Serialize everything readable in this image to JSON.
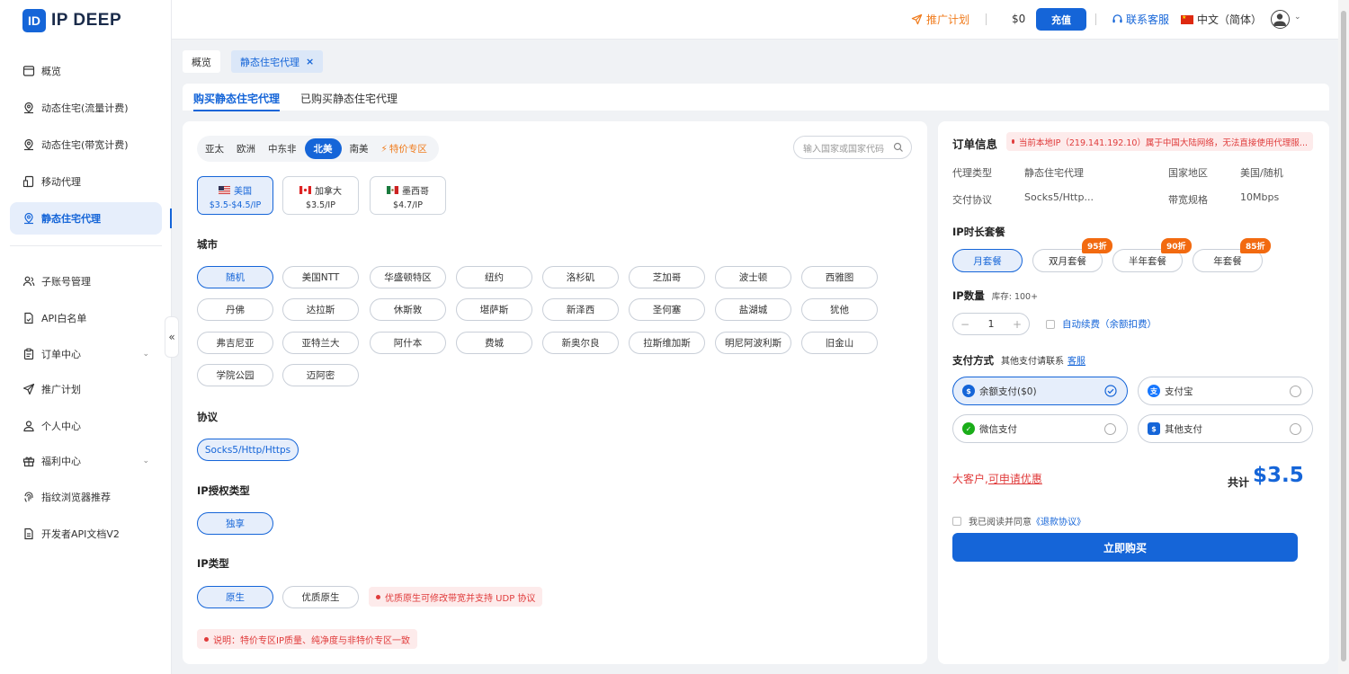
{
  "brand": {
    "logo_letter": "ID",
    "name": "IP DEEP"
  },
  "sidebar": {
    "items": [
      {
        "label": "概览"
      },
      {
        "label": "动态住宅(流量计费)"
      },
      {
        "label": "动态住宅(带宽计费)"
      },
      {
        "label": "移动代理"
      },
      {
        "label": "静态住宅代理"
      },
      {
        "label": "子账号管理"
      },
      {
        "label": "API白名单"
      },
      {
        "label": "订单中心"
      },
      {
        "label": "推广计划"
      },
      {
        "label": "个人中心"
      },
      {
        "label": "福利中心"
      },
      {
        "label": "指纹浏览器推荐"
      },
      {
        "label": "开发者API文档V2"
      }
    ],
    "collapse_glyph": "«"
  },
  "topbar": {
    "promo": "推广计划",
    "balance": "$0",
    "recharge": "充值",
    "service": "联系客服",
    "language": "中文（简体）"
  },
  "tabs": {
    "overview": "概览",
    "current": "静态住宅代理",
    "close": "×"
  },
  "subtabs": {
    "buy": "购买静态住宅代理",
    "purchased": "已购买静态住宅代理"
  },
  "regions": [
    "亚太",
    "欧洲",
    "中东非",
    "北美",
    "南美",
    "特价专区"
  ],
  "search_placeholder": "输入国家或国家代码",
  "countries": [
    {
      "name": "美国",
      "price": "$3.5-$4.5/IP"
    },
    {
      "name": "加拿大",
      "price": "$3.5/IP"
    },
    {
      "name": "墨西哥",
      "price": "$4.7/IP"
    }
  ],
  "city_label": "城市",
  "cities": [
    [
      "随机",
      "美国NTT",
      "华盛顿特区",
      "纽约",
      "洛杉矶",
      "芝加哥",
      "波士顿",
      "西雅图"
    ],
    [
      "丹佛",
      "达拉斯",
      "休斯敦",
      "堪萨斯",
      "新泽西",
      "圣何塞",
      "盐湖城",
      "犹他"
    ],
    [
      "弗吉尼亚",
      "亚特兰大",
      "阿什本",
      "费城",
      "新奥尔良",
      "拉斯维加斯",
      "明尼阿波利斯",
      "旧金山"
    ],
    [
      "学院公园",
      "迈阿密"
    ]
  ],
  "protocol_label": "协议",
  "protocol": "Socks5/Http/Https",
  "auth_label": "IP授权类型",
  "auth": "独享",
  "iptype_label": "IP类型",
  "iptypes": [
    "原生",
    "优质原生"
  ],
  "iptype_note": "优质原生可修改带宽并支持 UDP 协议",
  "footer_note": "说明：特价专区IP质量、纯净度与非特价专区一致",
  "order": {
    "title": "订单信息",
    "warning": "当前本地IP（219.141.192.10）属于中国大陆网络，无法直接使用代理服...",
    "proxy_type_k": "代理类型",
    "proxy_type_v": "静态住宅代理",
    "region_k": "国家地区",
    "region_v": "美国/随机",
    "protocol_k": "交付协议",
    "protocol_v": "Socks5/Http...",
    "bandwidth_k": "带宽规格",
    "bandwidth_v": "10Mbps",
    "duration_label": "IP时长套餐",
    "packages": [
      "月套餐",
      "双月套餐",
      "半年套餐",
      "年套餐"
    ],
    "discounts": [
      "95折",
      "90折",
      "85折"
    ],
    "qty_label": "IP数量",
    "stock": "库存: 100+",
    "qty_minus": "−",
    "qty_value": "1",
    "qty_plus": "+",
    "auto_renew": "自动续费（余额扣费）",
    "pay_label": "支付方式",
    "pay_other": "其他支付请联系",
    "pay_other_link": "客服",
    "payments": [
      "余额支付($0)",
      "支付宝",
      "微信支付",
      "其他支付"
    ],
    "big_customer": "大客户,",
    "big_customer_link": "可申请优惠",
    "total_label": "共计",
    "total_value": "$3.5",
    "agree_text": "我已阅读并同意",
    "agree_link": "《退款协议》",
    "buy": "立即购买"
  },
  "colors": {
    "primary": "#1565d8",
    "orange": "#f07b1c",
    "danger": "#e03b3b"
  }
}
